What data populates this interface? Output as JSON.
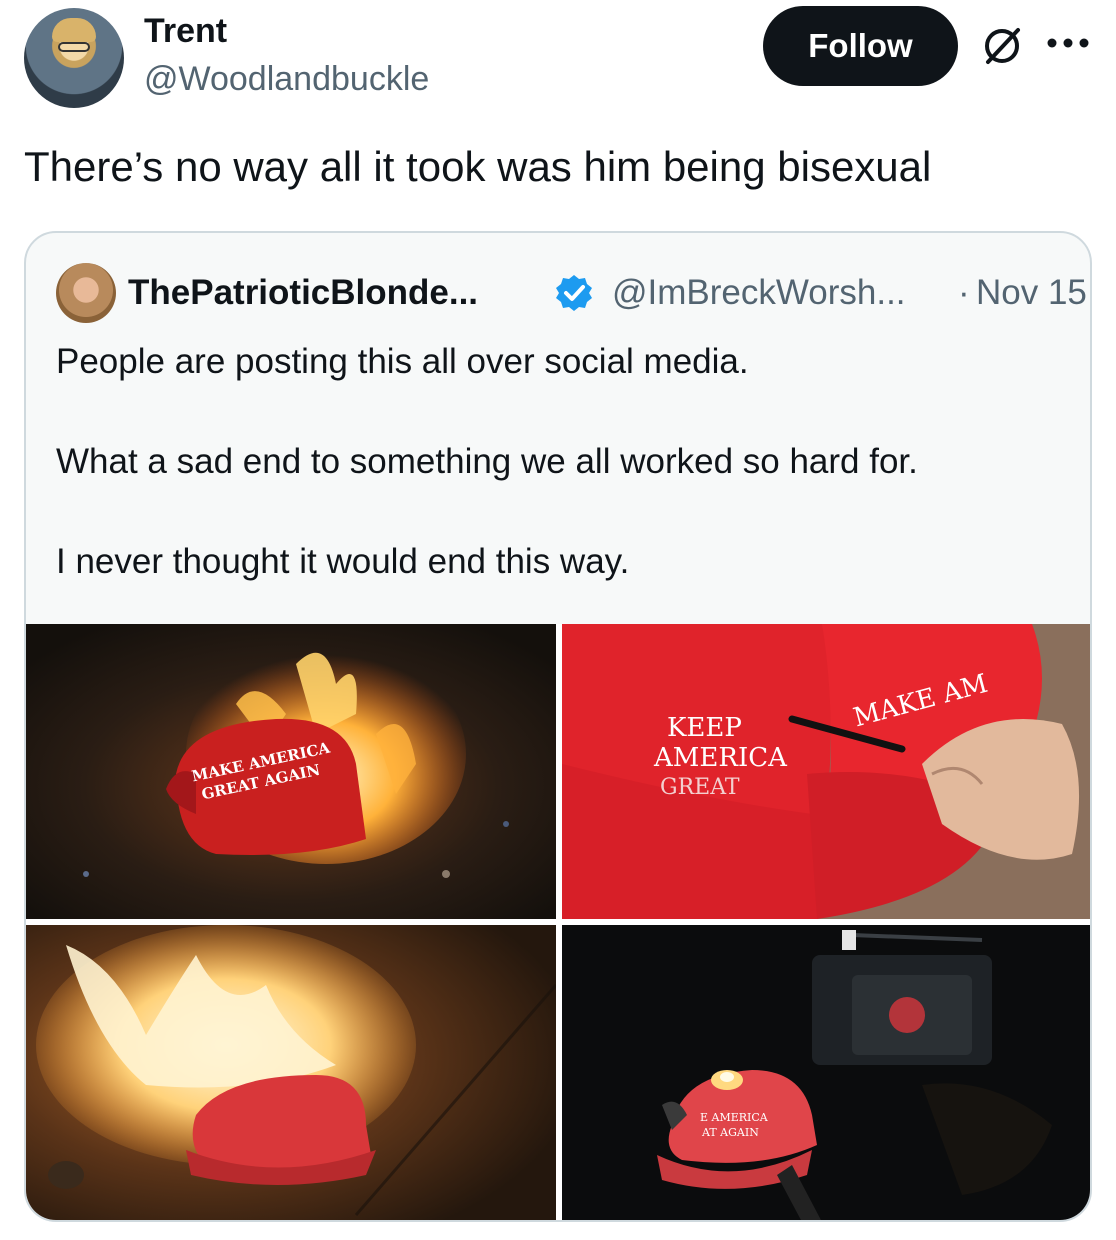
{
  "author": {
    "name": "Trent",
    "handle": "@Woodlandbuckle",
    "avatar_icon": "profile-avatar"
  },
  "actions": {
    "follow_label": "Follow",
    "grok_icon": "grok-icon",
    "more_icon": "more-icon"
  },
  "tweet": {
    "text": "There’s no way all it took was him being bisexual"
  },
  "quote": {
    "name": "ThePatrioticBlonde...",
    "handle": "@ImBreckWorsh...",
    "separator": "·",
    "date": "Nov 15",
    "verified_icon": "verified-badge-icon",
    "lines": [
      "People are posting this all over social media.",
      "What a sad end to something we all worked so hard for.",
      "I never thought it would end this way."
    ],
    "images": [
      {
        "hat_text_1": "MAKE AMERICA",
        "hat_text_2": "GREAT AGAIN"
      },
      {
        "hat_text_1": "KEEP",
        "hat_text_2": "AMERICA",
        "hat_text_3": "GREAT",
        "hat_text_4": "MAKE AM"
      },
      {
        "hat_text_1": "",
        "hat_text_2": ""
      },
      {
        "hat_text_1": "E AMERICA",
        "hat_text_2": "AT AGAIN"
      }
    ]
  },
  "colors": {
    "text_primary": "#0f1419",
    "text_secondary": "#536471",
    "border": "#cfd9de",
    "verified_blue": "#1d9bf0",
    "follow_bg": "#0f1419"
  }
}
